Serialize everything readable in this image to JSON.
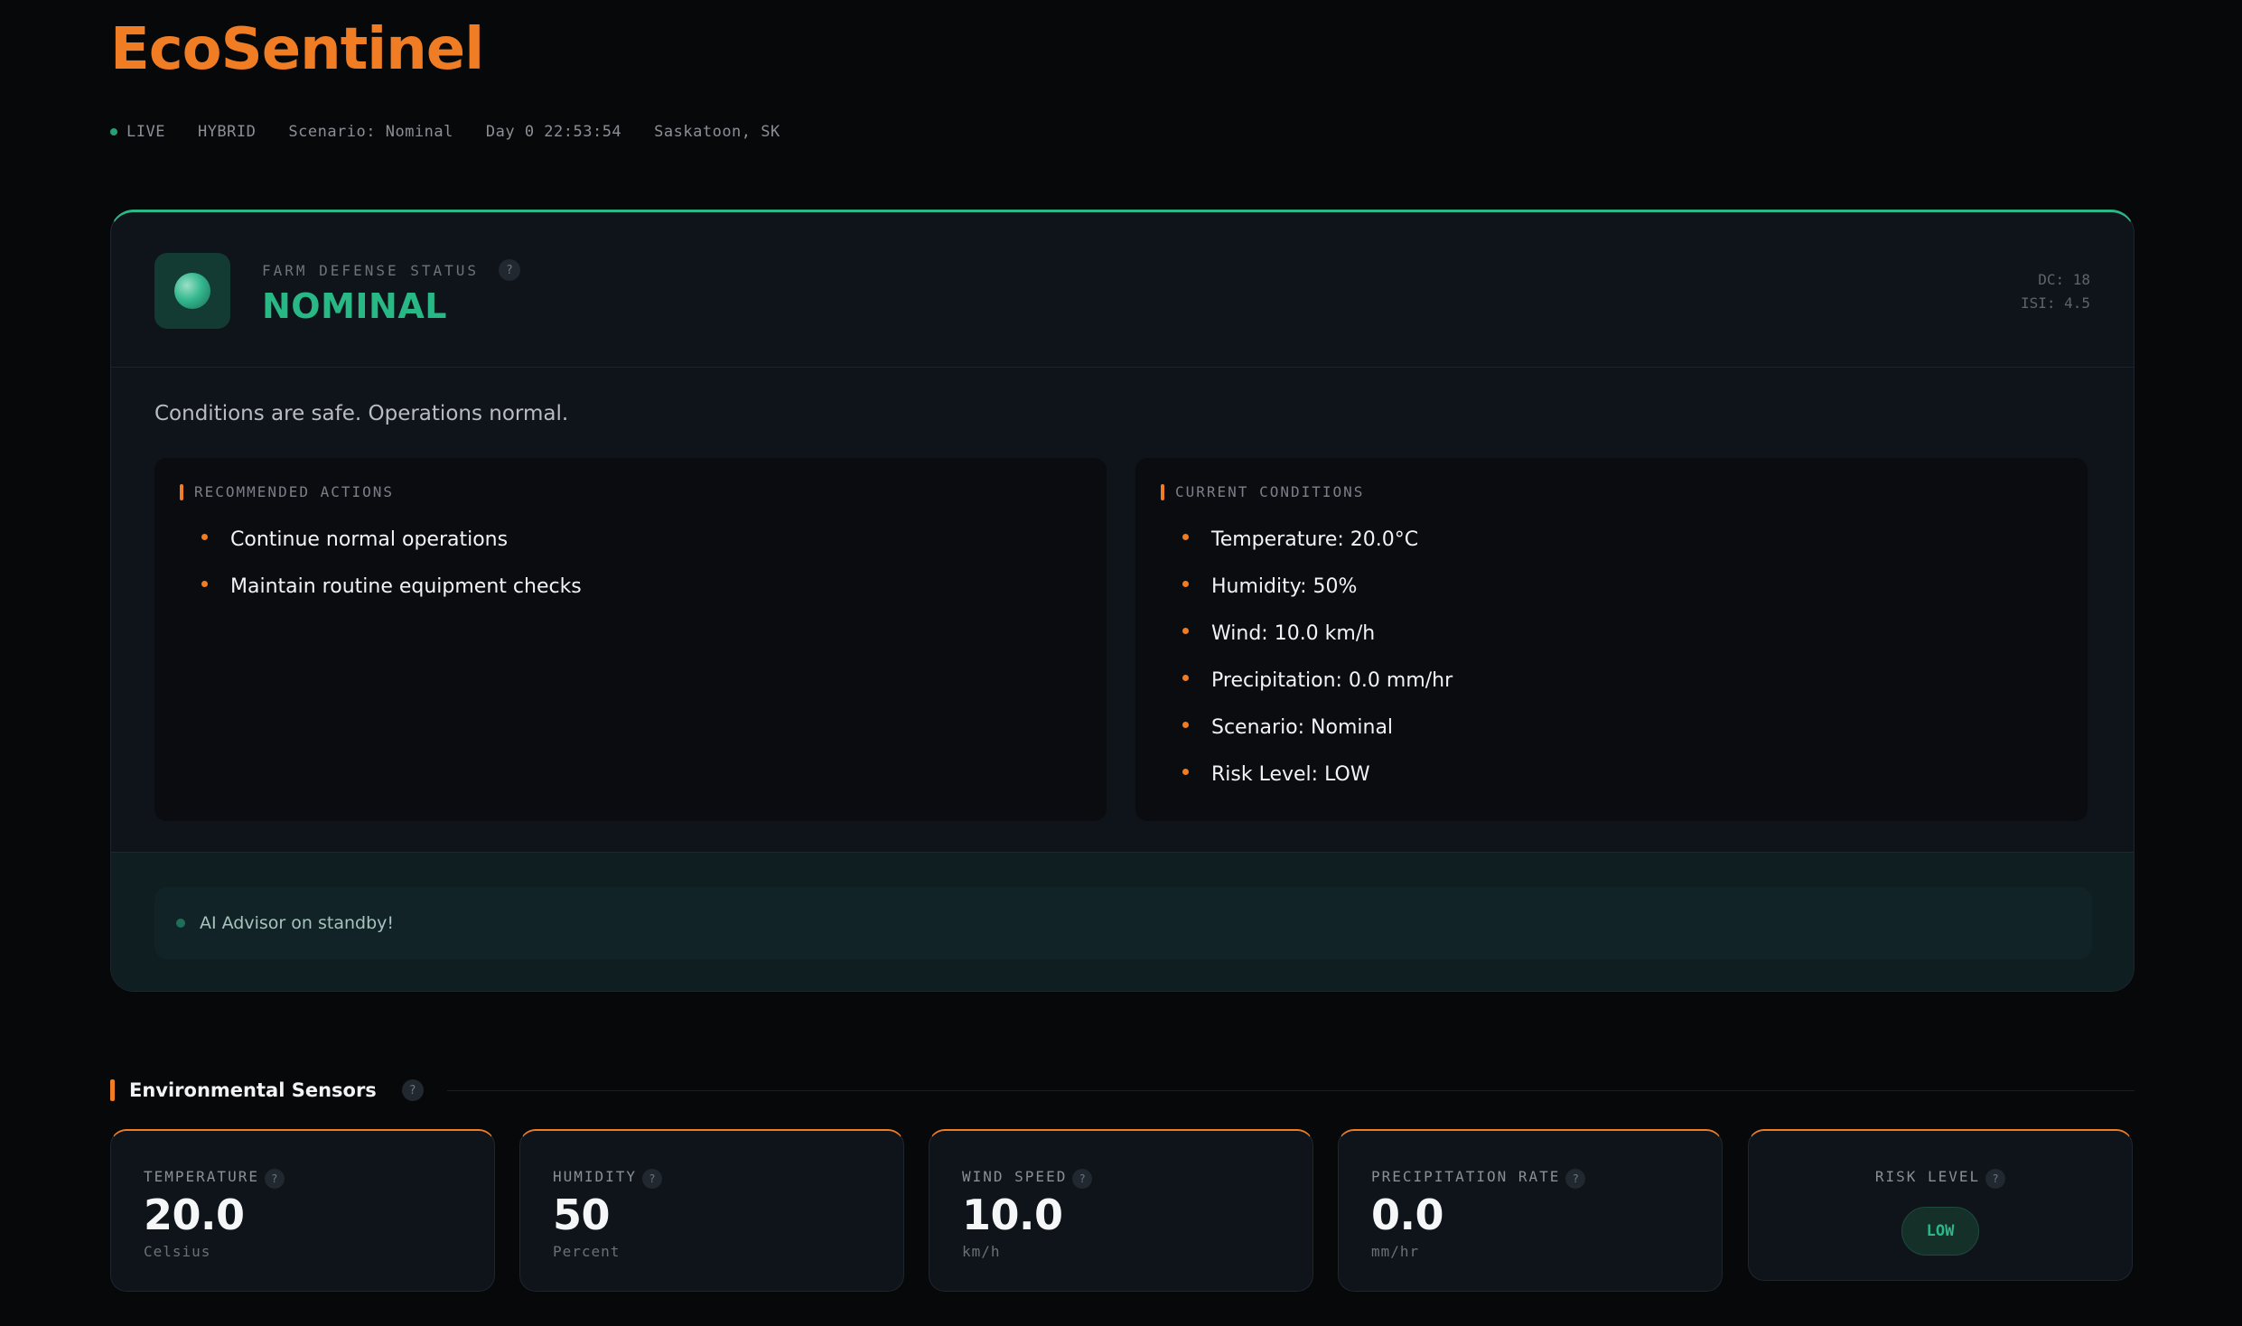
{
  "app": {
    "title": "EcoSentinel"
  },
  "statusbar": {
    "live": "LIVE",
    "mode": "HYBRID",
    "scenario": "Scenario: Nominal",
    "clock": "Day 0 22:53:54",
    "location": "Saskatoon, SK"
  },
  "defense": {
    "label": "FARM DEFENSE STATUS",
    "help": "?",
    "status": "NOMINAL",
    "dc": "DC: 18",
    "isi": "ISI: 4.5",
    "summary": "Conditions are safe. Operations normal.",
    "recommended": {
      "title": "RECOMMENDED ACTIONS",
      "items": [
        "Continue normal operations",
        "Maintain routine equipment checks"
      ]
    },
    "conditions": {
      "title": "CURRENT CONDITIONS",
      "items": [
        "Temperature: 20.0°C",
        "Humidity: 50%",
        "Wind: 10.0 km/h",
        "Precipitation: 0.0 mm/hr",
        "Scenario: Nominal",
        "Risk Level: LOW"
      ]
    },
    "advisor": "AI Advisor on standby!"
  },
  "sensors": {
    "title": "Environmental Sensors",
    "help": "?",
    "items": [
      {
        "label": "TEMPERATURE",
        "value": "20.0",
        "unit": "Celsius"
      },
      {
        "label": "HUMIDITY",
        "value": "50",
        "unit": "Percent"
      },
      {
        "label": "WIND SPEED",
        "value": "10.0",
        "unit": "km/h"
      },
      {
        "label": "PRECIPITATION RATE",
        "value": "0.0",
        "unit": "mm/hr"
      }
    ],
    "risk": {
      "label": "RISK LEVEL",
      "value": "LOW"
    }
  },
  "colors": {
    "accent": "#f07d24",
    "nominal": "#27b886",
    "background": "#07080a",
    "card": "#0f141a"
  },
  "icons": {
    "status_indicator": "shield-orb-icon",
    "help": "help-icon",
    "live": "live-dot-icon",
    "advisor": "advisor-status-dot-icon"
  }
}
